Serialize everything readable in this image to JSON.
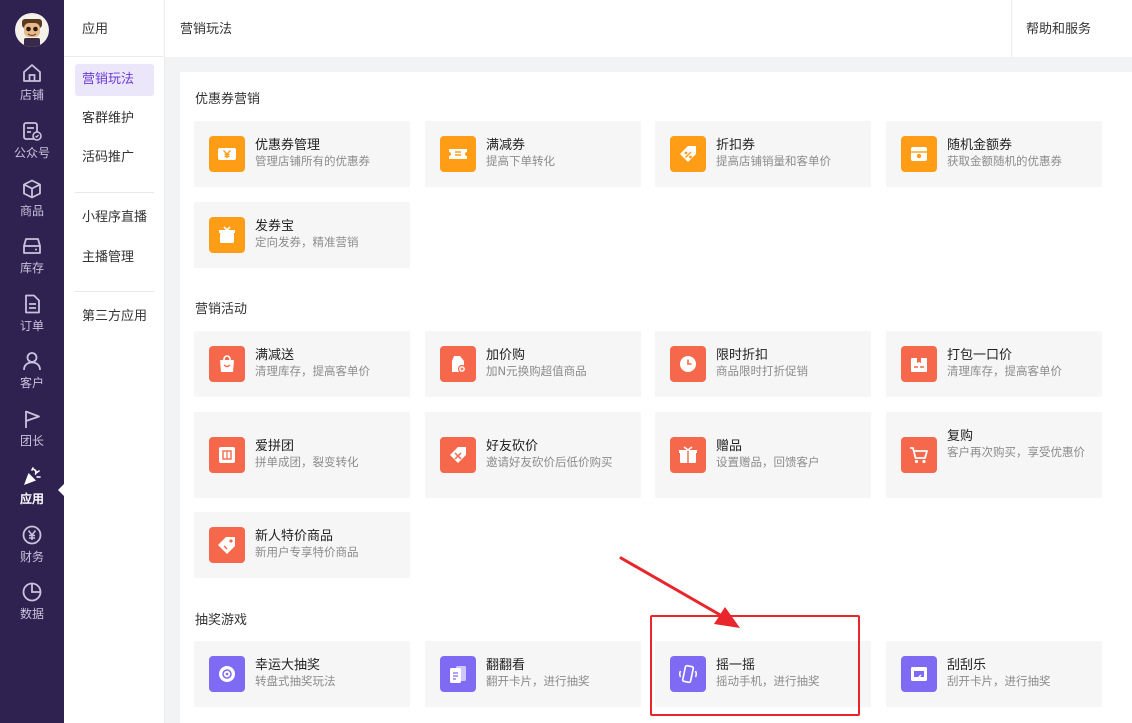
{
  "rail": {
    "items": [
      {
        "key": "store",
        "label": "店铺",
        "icon": "home-icon"
      },
      {
        "key": "official",
        "label": "公众号",
        "icon": "official-account-icon"
      },
      {
        "key": "goods",
        "label": "商品",
        "icon": "box-icon"
      },
      {
        "key": "stock",
        "label": "库存",
        "icon": "inventory-icon"
      },
      {
        "key": "orders",
        "label": "订单",
        "icon": "document-icon"
      },
      {
        "key": "customers",
        "label": "客户",
        "icon": "user-icon"
      },
      {
        "key": "leader",
        "label": "团长",
        "icon": "flag-icon"
      },
      {
        "key": "apps",
        "label": "应用",
        "icon": "party-popper-icon"
      },
      {
        "key": "finance",
        "label": "财务",
        "icon": "yen-icon"
      },
      {
        "key": "data",
        "label": "数据",
        "icon": "pie-chart-icon"
      }
    ],
    "active": "应用"
  },
  "subnav": {
    "title": "应用",
    "items": [
      "营销玩法",
      "客群维护",
      "活码推广",
      "小程序直播",
      "主播管理",
      "第三方应用"
    ]
  },
  "topbar": {
    "title": "营销玩法",
    "help": "帮助和服务"
  },
  "sections": [
    {
      "title": "优惠券营销",
      "cards": [
        {
          "name": "优惠券管理",
          "desc": "管理店铺所有的优惠券",
          "icon": "coupon-yen-icon",
          "color": "#ff9e16"
        },
        {
          "name": "满减券",
          "desc": "提高下单转化",
          "icon": "ticket-icon",
          "color": "#ff9e16"
        },
        {
          "name": "折扣券",
          "desc": "提高店铺销量和客单价",
          "icon": "percent-tag-icon",
          "color": "#ff9e16"
        },
        {
          "name": "随机金额券",
          "desc": "获取金额随机的优惠券",
          "icon": "random-coupon-icon",
          "color": "#ff9e16"
        },
        {
          "name": "发券宝",
          "desc": "定向发券，精准营销",
          "icon": "gift-box-icon",
          "color": "#ff9e16"
        }
      ]
    },
    {
      "title": "营销活动",
      "cards": [
        {
          "name": "满减送",
          "desc": "清理库存，提高客单价",
          "icon": "shopping-bag-icon",
          "color": "#f5684b"
        },
        {
          "name": "加价购",
          "desc": "加N元换购超值商品",
          "icon": "price-tag-plus-icon",
          "color": "#f5684b"
        },
        {
          "name": "限时折扣",
          "desc": "商品限时打折促销",
          "icon": "clock-icon",
          "color": "#f5684b"
        },
        {
          "name": "打包一口价",
          "desc": "清理库存，提高客单价",
          "icon": "package-icon",
          "color": "#f5684b"
        },
        {
          "name": "爱拼团",
          "desc": "拼单成团，裂变转化",
          "icon": "group-buy-icon",
          "color": "#f5684b"
        },
        {
          "name": "好友砍价",
          "desc": "邀请好友砍价后低价购买",
          "icon": "bargain-icon",
          "color": "#f5684b"
        },
        {
          "name": "赠品",
          "desc": "设置赠品，回馈客户",
          "icon": "gift-icon",
          "color": "#f5684b"
        },
        {
          "name": "复购",
          "desc": "客户再次购买，享受优惠价",
          "icon": "cart-icon",
          "color": "#f5684b"
        },
        {
          "name": "新人特价商品",
          "desc": "新用户专享特价商品",
          "icon": "new-user-tag-icon",
          "color": "#f5684b"
        }
      ]
    },
    {
      "title": "抽奖游戏",
      "cards": [
        {
          "name": "幸运大抽奖",
          "desc": "转盘式抽奖玩法",
          "icon": "lucky-wheel-icon",
          "color": "#7f6bf3"
        },
        {
          "name": "翻翻看",
          "desc": "翻开卡片，进行抽奖",
          "icon": "flip-cards-icon",
          "color": "#7f6bf3"
        },
        {
          "name": "摇一摇",
          "desc": "摇动手机，进行抽奖",
          "icon": "shake-phone-icon",
          "color": "#7f6bf3"
        },
        {
          "name": "刮刮乐",
          "desc": "刮开卡片，进行抽奖",
          "icon": "scratch-card-icon",
          "color": "#7f6bf3"
        }
      ]
    }
  ]
}
